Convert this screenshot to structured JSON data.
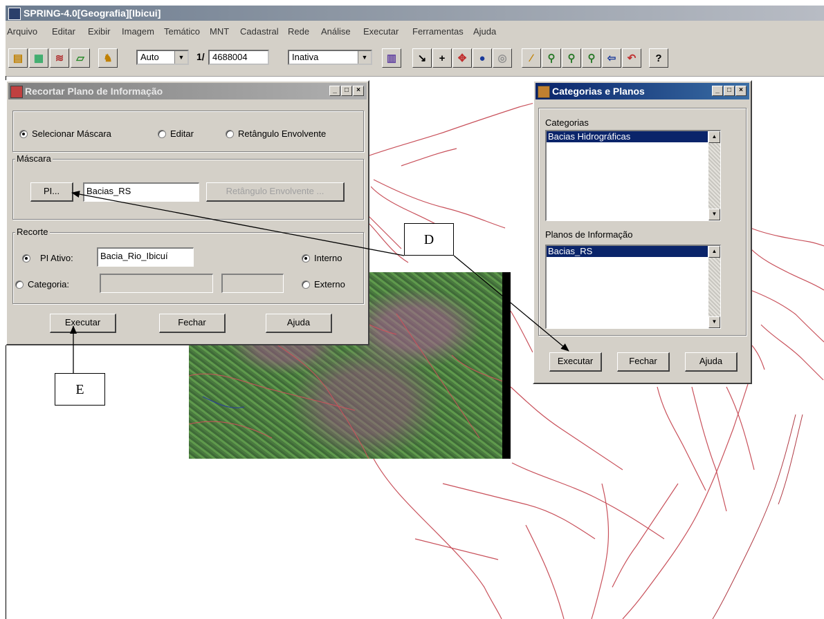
{
  "app": {
    "title": "SPRING-4.0[Geografia][Ibicui]"
  },
  "menu": [
    "Arquivo",
    "Editar",
    "Exibir",
    "Imagem",
    "Temático",
    "MNT",
    "Cadastral",
    "Rede",
    "Análise",
    "Executar",
    "Ferramentas",
    "Ajuda"
  ],
  "toolbar": {
    "scale_mode": "Auto",
    "scale_prefix": "1/",
    "scale_value": "4688004",
    "cursor_state": "Inativa",
    "help_glyph": "?"
  },
  "recortar": {
    "title": "Recortar Plano de Informação",
    "mode_options": [
      "Selecionar Máscara",
      "Editar",
      "Retângulo Envolvente"
    ],
    "selected_mode": "Selecionar Máscara",
    "mascara_group": "Máscara",
    "pi_button": "PI...",
    "mask_value": "Bacias_RS",
    "ret_button": "Retângulo Envolvente ...",
    "recorte_group": "Recorte",
    "pi_ativo_label": "PI Ativo:",
    "pi_ativo_value": "Bacia_Rio_Ibicuí",
    "categoria_label": "Categoria:",
    "interno_label": "Interno",
    "externo_label": "Externo",
    "executar": "Executar",
    "fechar": "Fechar",
    "ajuda": "Ajuda"
  },
  "categorias": {
    "title": "Categorias e Planos",
    "categorias_label": "Categorias",
    "categorias_items": [
      "Bacias Hidrográficas"
    ],
    "planos_label": "Planos de Informação",
    "planos_items": [
      "Bacias_RS"
    ],
    "executar": "Executar",
    "fechar": "Fechar",
    "ajuda": "Ajuda"
  },
  "callouts": {
    "d": "D",
    "e": "E"
  },
  "colors": {
    "map_lines": "#c8505a",
    "selection": "#0a246a",
    "dialog_bg": "#d4d0c8"
  }
}
